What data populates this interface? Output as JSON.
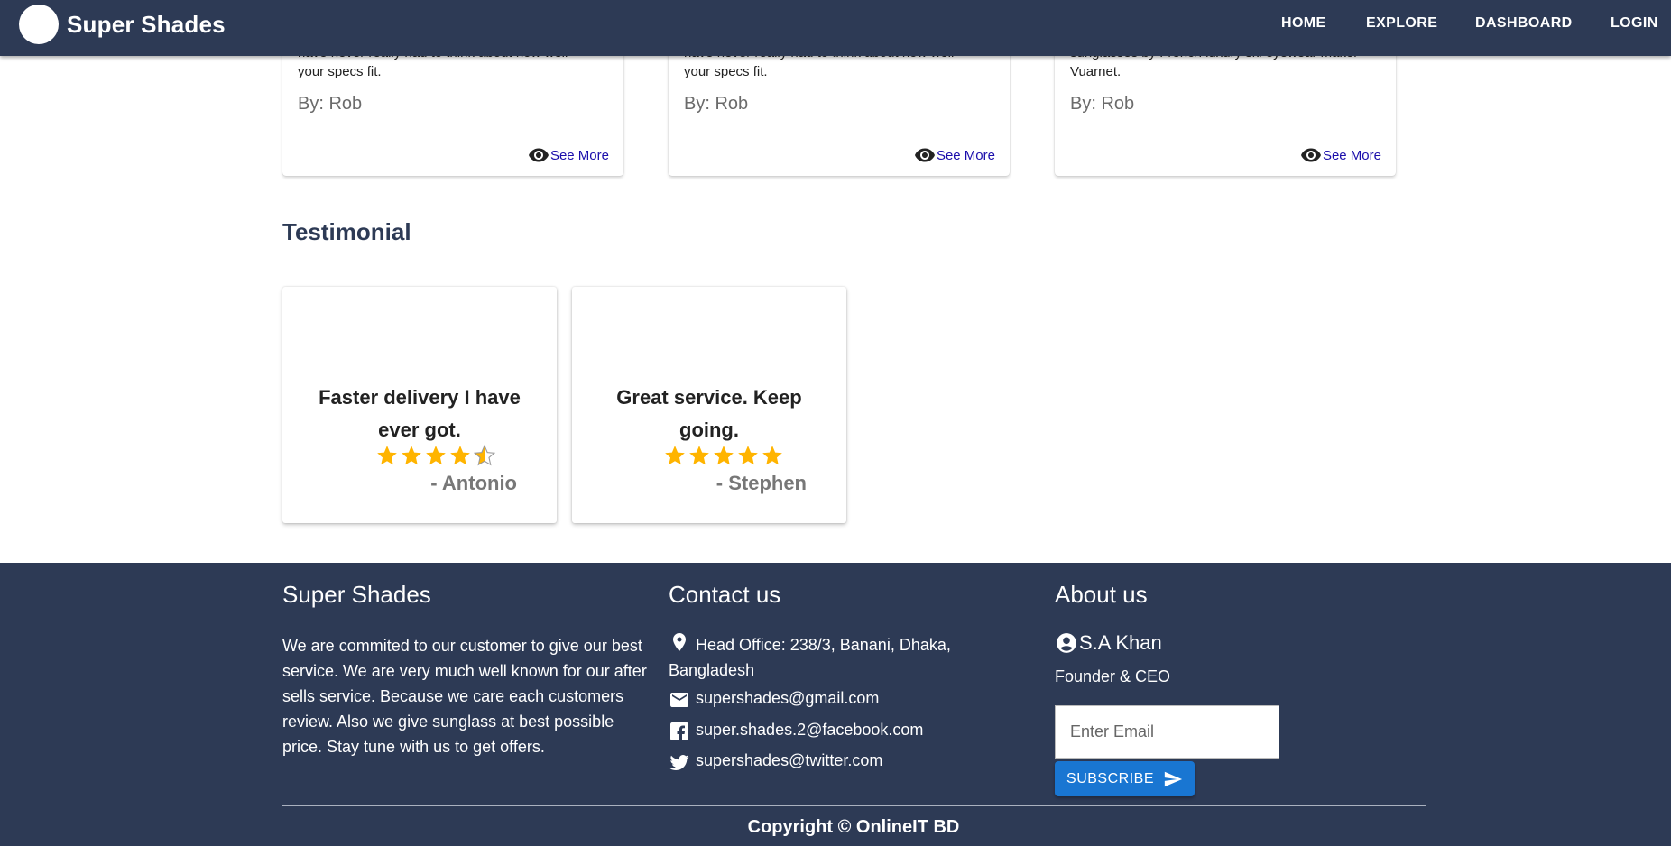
{
  "navbar": {
    "brand": "Super Shades",
    "links": [
      "HOME",
      "EXPLORE",
      "DASHBOARD",
      "LOGIN"
    ]
  },
  "products": [
    {
      "cut_text": "have never really had to think about how well",
      "desc": "your specs fit.",
      "author": "By: Rob",
      "link": "See More"
    },
    {
      "cut_text": "have never really had to think about how well",
      "desc": "your specs fit.",
      "author": "By: Rob",
      "link": "See More"
    },
    {
      "cut_text": "sunglasses by French luxury ski eyewear maker",
      "desc": "Vuarnet.",
      "author": "By: Rob",
      "link": "See More"
    }
  ],
  "testimonial": {
    "title": "Testimonial",
    "items": [
      {
        "quote": "Faster delivery I have ever got.",
        "rating": 4.5,
        "author": "- Antonio"
      },
      {
        "quote": "Great service. Keep going.",
        "rating": 5,
        "author": "- Stephen"
      }
    ],
    "star_color": "#ffb400"
  },
  "footer": {
    "about_title": "Super Shades",
    "about_text": "We are commited to our customer to give our best service. We are very much well known for our after sells service. Because we care each customers review. Also we give sunglass at best possible price. Stay tune with us to get offers.",
    "contact_title": "Contact us",
    "address": "Head Office: 238/3, Banani, Dhaka, Bangladesh",
    "email": "supershades@gmail.com",
    "facebook": "super.shades.2@facebook.com",
    "twitter": "supershades@twitter.com",
    "about_us_title": "About us",
    "person_name": "S.A Khan",
    "person_role": "Founder & CEO",
    "email_placeholder": "Enter Email",
    "subscribe_label": "SUBSCRIBE",
    "copyright": "Copyright © OnlineIT BD"
  },
  "colors": {
    "navy": "#2d3a55",
    "button_blue": "#1976d2",
    "link_blue": "#1a0dab"
  }
}
